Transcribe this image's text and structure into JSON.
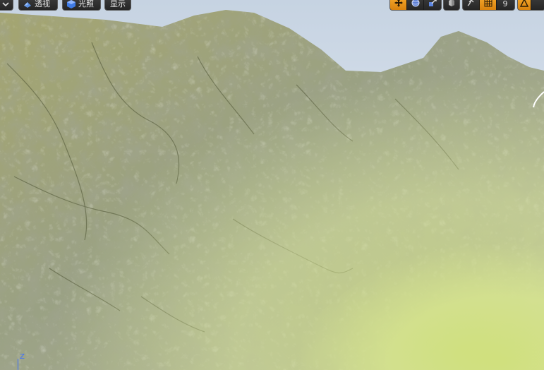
{
  "toolbar": {
    "left_dropdown_icon": "chevron-down-icon",
    "perspective_label": "透视",
    "perspective_icon": "perspective-cube-icon",
    "lighting_label": "光照",
    "lighting_icon": "lit-sphere-icon",
    "show_label": "显示",
    "snap_value": "9",
    "accent_color": "#e8951c"
  },
  "axis": {
    "z_label": "Z",
    "color": "#3c6fff"
  },
  "scene": {
    "sky_color": "#dfe6ee",
    "rock_color": "#9da27a",
    "grass_color": "#c9dc78"
  }
}
